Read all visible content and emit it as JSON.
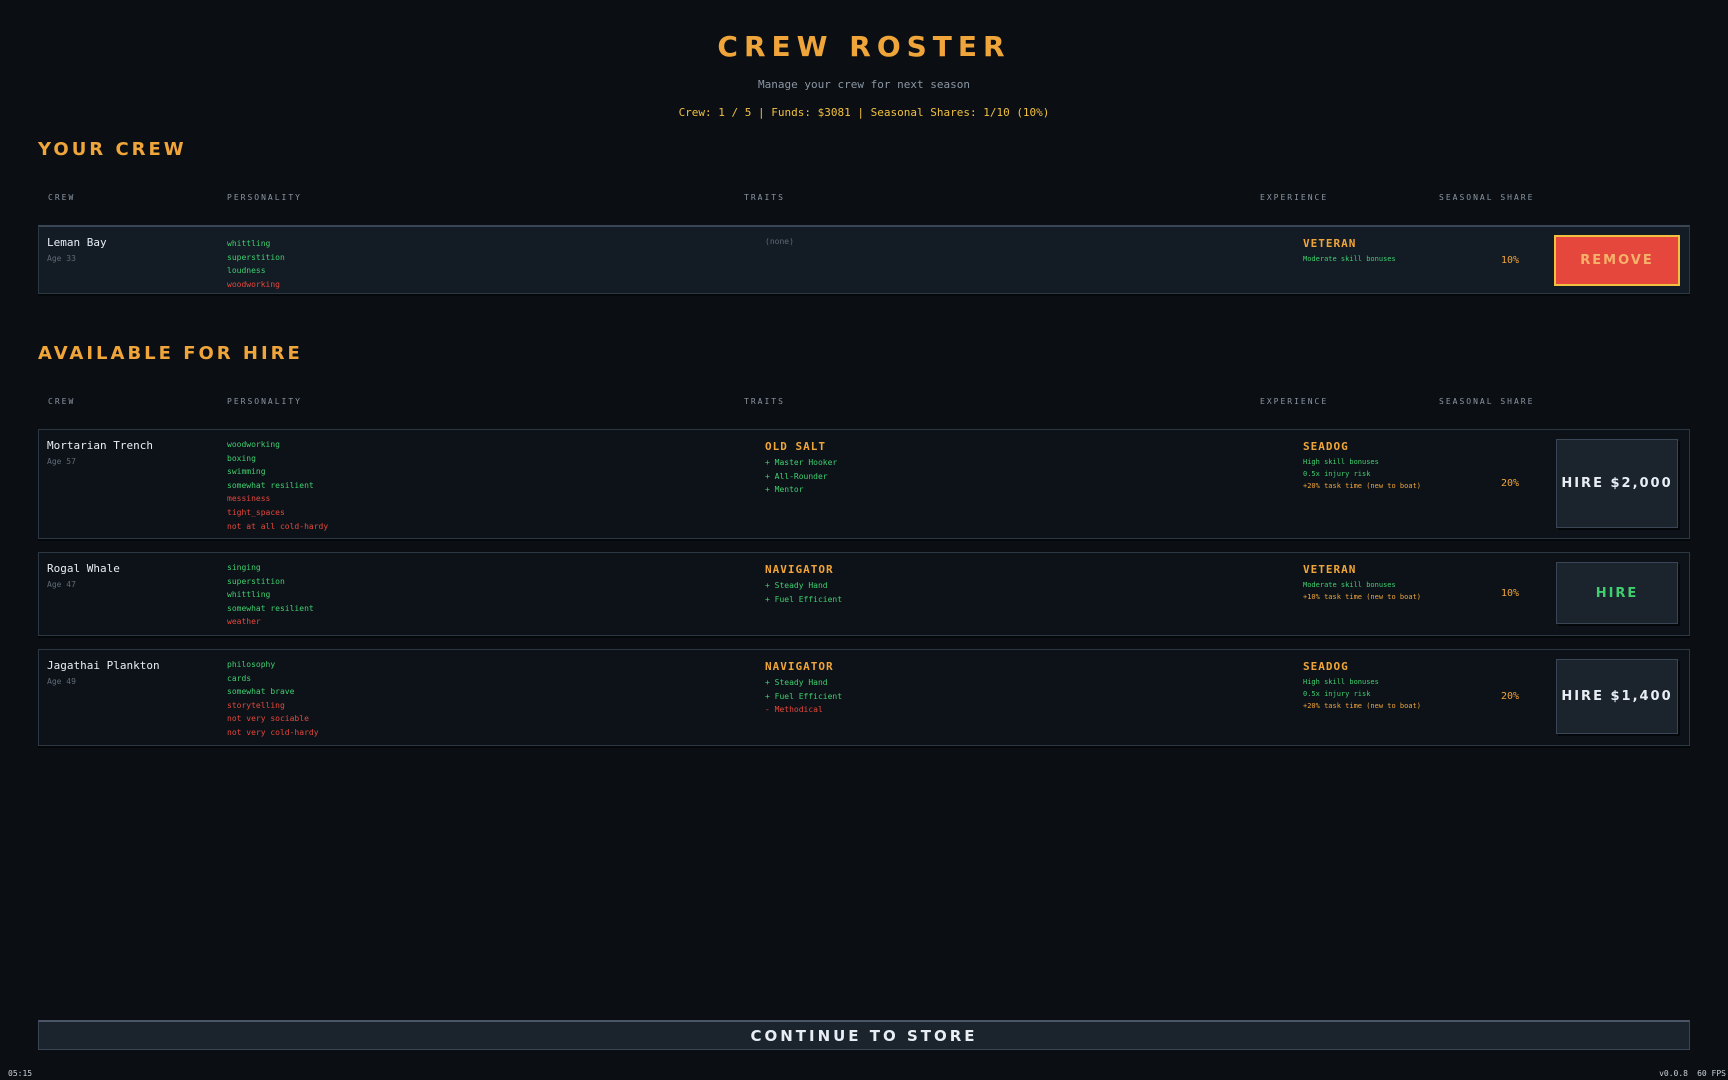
{
  "header": {
    "title": "CREW ROSTER",
    "subtitle": "Manage your crew for next season",
    "stats": "Crew: 1 / 5  |  Funds: $3081  |  Seasonal Shares: 1/10 (10%)"
  },
  "columns": {
    "crew": "CREW",
    "personality": "PERSONALITY",
    "traits": "TRAITS",
    "experience": "EXPERIENCE",
    "share": "SEASONAL SHARE"
  },
  "your_crew": {
    "title": "YOUR CREW",
    "members": [
      {
        "name": "Leman Bay",
        "age": "Age 33",
        "personality": [
          {
            "text": "whittling",
            "tone": "good"
          },
          {
            "text": "superstition",
            "tone": "good"
          },
          {
            "text": "loudness",
            "tone": "good"
          },
          {
            "text": "woodworking",
            "tone": "bad"
          }
        ],
        "trait_empty": "(none)",
        "experience": "VETERAN",
        "experience_notes": [
          {
            "text": "Moderate skill bonuses",
            "tone": "good"
          }
        ],
        "share": "10%",
        "action": "REMOVE"
      }
    ]
  },
  "available": {
    "title": "AVAILABLE FOR HIRE",
    "candidates": [
      {
        "name": "Mortarian Trench",
        "age": "Age 57",
        "personality": [
          {
            "text": "woodworking",
            "tone": "good"
          },
          {
            "text": "boxing",
            "tone": "good"
          },
          {
            "text": "swimming",
            "tone": "good"
          },
          {
            "text": "somewhat resilient",
            "tone": "good"
          },
          {
            "text": "messiness",
            "tone": "bad"
          },
          {
            "text": "tight_spaces",
            "tone": "bad"
          },
          {
            "text": "not at all cold-hardy",
            "tone": "bad"
          }
        ],
        "trait_title": "OLD SALT",
        "traits": [
          {
            "text": "+ Master Hooker",
            "tone": "good"
          },
          {
            "text": "+ All-Rounder",
            "tone": "good"
          },
          {
            "text": "+ Mentor",
            "tone": "good"
          }
        ],
        "experience": "SEADOG",
        "experience_notes": [
          {
            "text": "High skill bonuses",
            "tone": "good"
          },
          {
            "text": "0.5x injury risk",
            "tone": "good"
          },
          {
            "text": "+20% task time (new to boat)",
            "tone": "gold"
          }
        ],
        "share": "20%",
        "action": "HIRE $2,000",
        "affordable": false
      },
      {
        "name": "Rogal Whale",
        "age": "Age 47",
        "personality": [
          {
            "text": "singing",
            "tone": "good"
          },
          {
            "text": "superstition",
            "tone": "good"
          },
          {
            "text": "whittling",
            "tone": "good"
          },
          {
            "text": "somewhat resilient",
            "tone": "good"
          },
          {
            "text": "weather",
            "tone": "bad"
          }
        ],
        "trait_title": "NAVIGATOR",
        "traits": [
          {
            "text": "+ Steady Hand",
            "tone": "good"
          },
          {
            "text": "+ Fuel Efficient",
            "tone": "good"
          }
        ],
        "experience": "VETERAN",
        "experience_notes": [
          {
            "text": "Moderate skill bonuses",
            "tone": "good"
          },
          {
            "text": "+10% task time (new to boat)",
            "tone": "gold"
          }
        ],
        "share": "10%",
        "action": "HIRE",
        "affordable": true
      },
      {
        "name": "Jagathai Plankton",
        "age": "Age 49",
        "personality": [
          {
            "text": "philosophy",
            "tone": "good"
          },
          {
            "text": "cards",
            "tone": "good"
          },
          {
            "text": "somewhat brave",
            "tone": "good"
          },
          {
            "text": "storytelling",
            "tone": "bad"
          },
          {
            "text": "not very sociable",
            "tone": "bad"
          },
          {
            "text": "not very cold-hardy",
            "tone": "bad"
          }
        ],
        "trait_title": "NAVIGATOR",
        "traits": [
          {
            "text": "+ Steady Hand",
            "tone": "good"
          },
          {
            "text": "+ Fuel Efficient",
            "tone": "good"
          },
          {
            "text": "- Methodical",
            "tone": "bad"
          }
        ],
        "experience": "SEADOG",
        "experience_notes": [
          {
            "text": "High skill bonuses",
            "tone": "good"
          },
          {
            "text": "0.5x injury risk",
            "tone": "good"
          },
          {
            "text": "+20% task time (new to boat)",
            "tone": "gold"
          }
        ],
        "share": "20%",
        "action": "HIRE $1,400",
        "affordable": false
      }
    ]
  },
  "footer": {
    "continue_label": "CONTINUE TO STORE",
    "clock": "05:15",
    "version": "v0.0.8",
    "fps": "60 FPS"
  },
  "colors": {
    "accent": "#f0a53a",
    "good": "#3fcf6f",
    "bad": "#e5473c",
    "background": "#0b0f14"
  }
}
